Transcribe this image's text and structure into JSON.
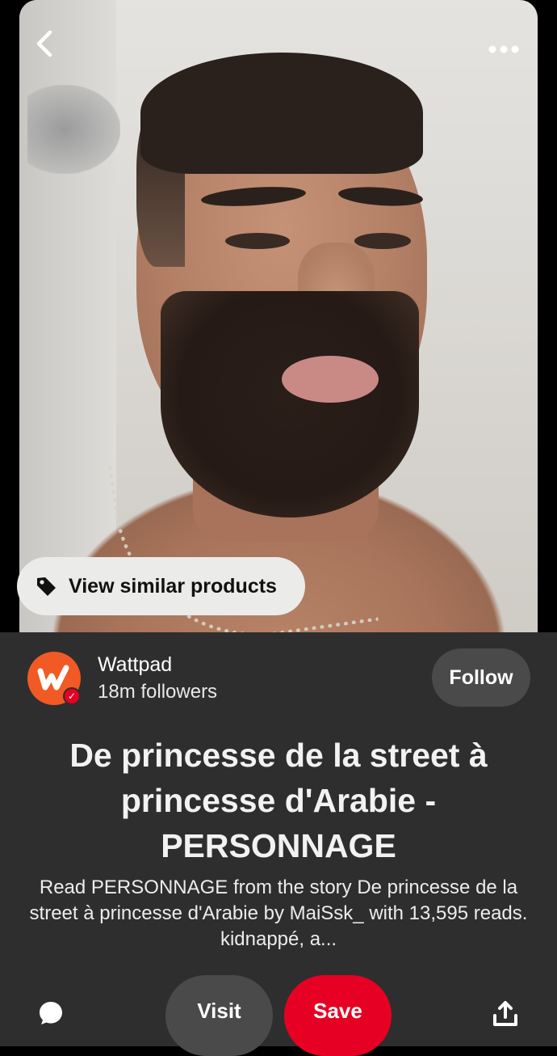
{
  "pin": {
    "image_alt": "Photo of a bearded man wearing a chain necklace",
    "similar_products_label": "View similar products"
  },
  "nav": {
    "back_icon": "chevron-left-icon",
    "more_icon": "more-horizontal-icon"
  },
  "creator": {
    "name": "Wattpad",
    "followers": "18m followers",
    "follow_label": "Follow",
    "avatar_color": "#f15a24",
    "verified_color": "#e60023"
  },
  "content": {
    "title": "De princesse de la street à princesse d'Arabie - PERSONNAGE",
    "description": "Read PERSONNAGE from the story De princesse de la street à princesse d'Arabie by MaiSsk_ with 13,595 reads. kidnappé, a..."
  },
  "actions": {
    "visit_label": "Visit",
    "save_label": "Save",
    "comment_icon": "comment-icon",
    "share_icon": "share-icon",
    "save_color": "#e60023"
  }
}
